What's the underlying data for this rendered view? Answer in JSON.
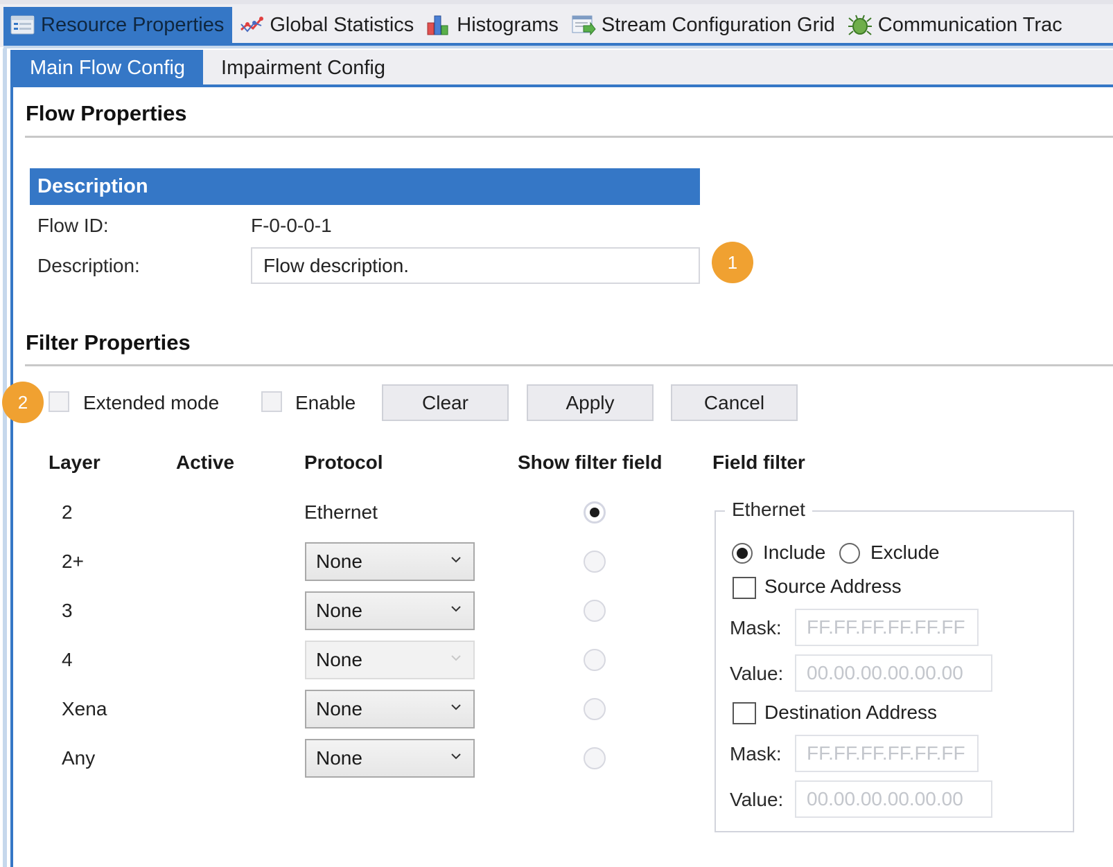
{
  "top_tabs": [
    {
      "label": "Resource Properties",
      "icon": "resource-properties-icon",
      "active": true
    },
    {
      "label": "Global Statistics",
      "icon": "line-chart-icon",
      "active": false
    },
    {
      "label": "Histograms",
      "icon": "bar-chart-icon",
      "active": false
    },
    {
      "label": "Stream Configuration Grid",
      "icon": "grid-arrow-icon",
      "active": false
    },
    {
      "label": "Communication Trac",
      "icon": "bug-icon",
      "active": false
    }
  ],
  "sub_tabs": [
    {
      "label": "Main Flow Config",
      "active": true
    },
    {
      "label": "Impairment Config",
      "active": false
    }
  ],
  "flow_properties": {
    "title": "Flow Properties",
    "description_header": "Description",
    "flow_id_label": "Flow ID:",
    "flow_id_value": "F-0-0-0-1",
    "description_label": "Description:",
    "description_value": "Flow description.",
    "callout": "1"
  },
  "filter_properties": {
    "title": "Filter Properties",
    "callout": "2",
    "extended_mode_label": "Extended mode",
    "extended_mode_checked": false,
    "enable_label": "Enable",
    "enable_checked": false,
    "buttons": {
      "clear": "Clear",
      "apply": "Apply",
      "cancel": "Cancel"
    },
    "columns": [
      "Layer",
      "Active",
      "Protocol",
      "Show filter field",
      "Field filter"
    ],
    "rows": [
      {
        "layer": "2",
        "protocol": "Ethernet",
        "protocol_type": "text",
        "show_filter": true
      },
      {
        "layer": "2+",
        "protocol": "None",
        "protocol_type": "select",
        "disabled": false,
        "show_filter": false
      },
      {
        "layer": "3",
        "protocol": "None",
        "protocol_type": "select",
        "disabled": false,
        "show_filter": false
      },
      {
        "layer": "4",
        "protocol": "None",
        "protocol_type": "select",
        "disabled": true,
        "show_filter": false
      },
      {
        "layer": "Xena",
        "protocol": "None",
        "protocol_type": "select",
        "disabled": false,
        "show_filter": false
      },
      {
        "layer": "Any",
        "protocol": "None",
        "protocol_type": "select",
        "disabled": false,
        "show_filter": false
      }
    ],
    "field_filter": {
      "group_title": "Ethernet",
      "include_label": "Include",
      "exclude_label": "Exclude",
      "mode": "include",
      "source_address_label": "Source Address",
      "source_address_checked": false,
      "source_mask_label": "Mask:",
      "source_mask_placeholder": "FF.FF.FF.FF.FF.FF",
      "source_value_label": "Value:",
      "source_value_placeholder": "00.00.00.00.00.00",
      "destination_address_label": "Destination Address",
      "destination_address_checked": false,
      "dest_mask_label": "Mask:",
      "dest_mask_placeholder": "FF.FF.FF.FF.FF.FF",
      "dest_value_label": "Value:",
      "dest_value_placeholder": "00.00.00.00.00.00"
    }
  },
  "colors": {
    "accent": "#3577c6",
    "callout": "#f0a131"
  }
}
